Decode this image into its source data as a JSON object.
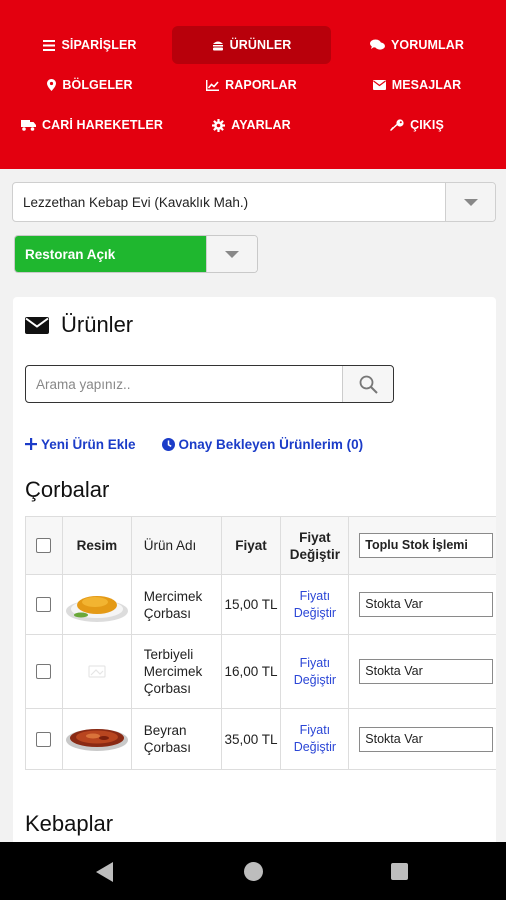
{
  "nav": {
    "items": [
      {
        "label": "SİPARİŞLER",
        "icon": "list-icon",
        "active": false
      },
      {
        "label": "ÜRÜNLER",
        "icon": "burger-icon",
        "active": true
      },
      {
        "label": "YORUMLAR",
        "icon": "comments-icon",
        "active": false
      },
      {
        "label": "BÖLGELER",
        "icon": "map-marker-icon",
        "active": false
      },
      {
        "label": "RAPORLAR",
        "icon": "chart-icon",
        "active": false
      },
      {
        "label": "MESAJLAR",
        "icon": "envelope-icon",
        "active": false
      },
      {
        "label": "CARİ HAREKETLER",
        "icon": "truck-icon",
        "active": false
      },
      {
        "label": "AYARLAR",
        "icon": "gear-icon",
        "active": false
      },
      {
        "label": "ÇIKIŞ",
        "icon": "key-icon",
        "active": false
      }
    ],
    "bg_color": "#e3000f"
  },
  "restaurant_select": {
    "value": "Lezzethan Kebap Evi (Kavaklık Mah.)"
  },
  "status_select": {
    "value": "Restoran Açık",
    "color": "#1fb72f"
  },
  "products": {
    "title": "Ürünler",
    "search_placeholder": "Arama yapınız..",
    "add_link": "Yeni Ürün Ekle",
    "pending_link": "Onay Bekleyen Ürünlerim (0)",
    "categories": [
      {
        "name": "Çorbalar"
      },
      {
        "name": "Kebaplar"
      }
    ],
    "table": {
      "headers": {
        "image": "Resim",
        "name": "Ürün Adı",
        "price": "Fiyat",
        "change": "Fiyat Değiştir",
        "bulk": "Toplu Stok İşlemi"
      },
      "rows": [
        {
          "name": "Mercimek Çorbası",
          "price": "15,00 TL",
          "change": "Fiyatı Değiştir",
          "stock": "Stokta Var",
          "image": "lentil-soup-photo"
        },
        {
          "name": "Terbiyeli Mercimek Çorbası",
          "price": "16,00 TL",
          "change": "Fiyatı Değiştir",
          "stock": "Stokta Var",
          "image": "placeholder-photo"
        },
        {
          "name": "Beyran Çorbası",
          "price": "35,00 TL",
          "change": "Fiyatı Değiştir",
          "stock": "Stokta Var",
          "image": "beyran-soup-photo"
        }
      ]
    }
  }
}
